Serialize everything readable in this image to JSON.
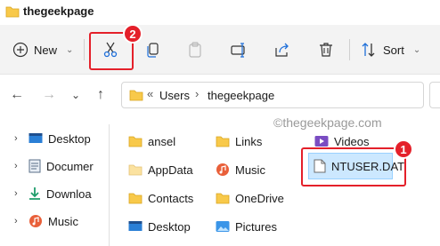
{
  "window": {
    "title": "thegeekpage"
  },
  "toolbar": {
    "new_label": "New",
    "sort_label": "Sort",
    "icons": [
      "cut-icon",
      "copy-icon",
      "paste-icon",
      "rename-icon",
      "share-icon",
      "delete-icon",
      "sort-icon"
    ]
  },
  "address": {
    "overflow": "«",
    "crumbs": [
      "Users",
      "thegeekpage"
    ],
    "separator": "›"
  },
  "watermark": "©thegeekpage.com",
  "sidebar": {
    "items": [
      {
        "label": "Desktop",
        "icon": "desktop-icon"
      },
      {
        "label": "Documer",
        "icon": "documents-icon"
      },
      {
        "label": "Downloa",
        "icon": "downloads-icon"
      },
      {
        "label": "Music",
        "icon": "music-icon"
      }
    ]
  },
  "files": {
    "col1": [
      "ansel",
      "AppData",
      "Contacts",
      "Desktop"
    ],
    "col2": [
      "Links",
      "Music",
      "OneDrive",
      "Pictures"
    ],
    "col3": [
      "Videos",
      "NTUSER.DAT"
    ]
  },
  "annotations": {
    "badge1": "1",
    "badge2": "2"
  },
  "colors": {
    "accent_red": "#e4202a",
    "selection": "#cce8ff",
    "folder_yellow": "#f8c94a"
  }
}
